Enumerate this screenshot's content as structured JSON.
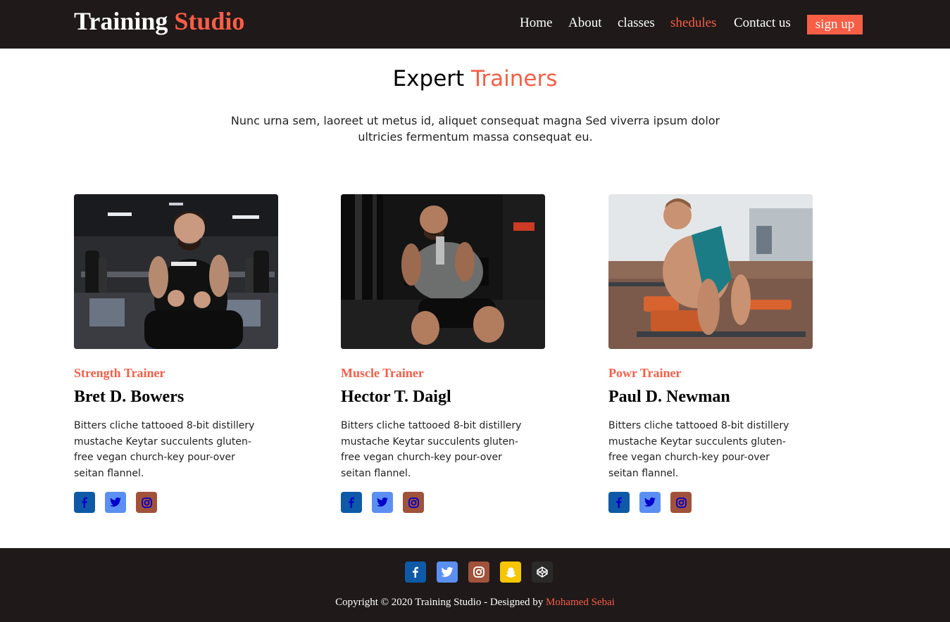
{
  "header": {
    "brand_main": "Training",
    "brand_accent": "Studio",
    "nav": [
      "Home",
      "About",
      "classes",
      "shedules",
      "Contact us"
    ],
    "active_nav": "shedules",
    "signup_label": "sign up"
  },
  "section": {
    "title_main": "Expert",
    "title_accent": "Trainers",
    "intro": "Nunc urna sem, laoreet ut metus id, aliquet consequat magna Sed viverra ipsum dolor ultricies fermentum massa consequat eu."
  },
  "trainers": [
    {
      "role": "Strength Trainer",
      "name": "Bret D. Bowers",
      "bio": "Bitters cliche tattooed 8-bit distillery mustache Keytar succulents gluten-free vegan church-key pour-over seitan flannel.",
      "socials": [
        "facebook-icon",
        "twitter-icon",
        "instagram-icon"
      ]
    },
    {
      "role": "Muscle Trainer",
      "name": "Hector T. Daigl",
      "bio": "Bitters cliche tattooed 8-bit distillery mustache Keytar succulents gluten-free vegan church-key pour-over seitan flannel.",
      "socials": [
        "facebook-icon",
        "twitter-icon",
        "instagram-icon"
      ]
    },
    {
      "role": "Powr Trainer",
      "name": "Paul D. Newman",
      "bio": "Bitters cliche tattooed 8-bit distillery mustache Keytar succulents gluten-free vegan church-key pour-over seitan flannel.",
      "socials": [
        "facebook-icon",
        "twitter-icon",
        "instagram-icon"
      ]
    }
  ],
  "footer": {
    "socials": [
      "facebook-icon",
      "twitter-icon",
      "instagram-icon",
      "snapchat-icon",
      "codepen-icon"
    ],
    "copyright": "Copyright © 2020 Training Studio - Designed by",
    "author": "Mohamed Sebai"
  },
  "colors": {
    "accent": "#f75e46",
    "dark_bar": "#1f1919",
    "facebook": "#0e5aa7",
    "twitter": "#5b8ff2",
    "instagram": "#a1523b",
    "snapchat": "#f7c600",
    "codepen": "#2a2a2a"
  }
}
